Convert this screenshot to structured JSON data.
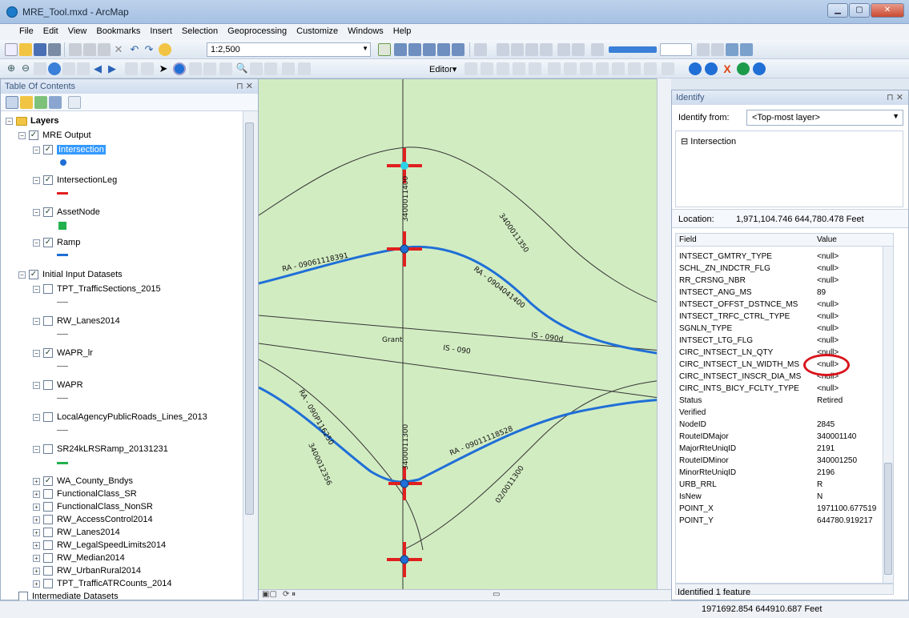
{
  "window": {
    "title": "MRE_Tool.mxd - ArcMap"
  },
  "menu": [
    "File",
    "Edit",
    "View",
    "Bookmarks",
    "Insert",
    "Selection",
    "Geoprocessing",
    "Customize",
    "Windows",
    "Help"
  ],
  "toolbar": {
    "scale": "1:2,500",
    "editor_label": "Editor▾"
  },
  "toc": {
    "title": "Table Of Contents",
    "root": "Layers",
    "groups": [
      {
        "name": "MRE Output",
        "checked": true,
        "layers": [
          {
            "name": "Intersection",
            "checked": true,
            "selected": true,
            "symbol": "blue-dot"
          },
          {
            "name": "IntersectionLeg",
            "checked": true,
            "symbol": "red-line"
          },
          {
            "name": "AssetNode",
            "checked": true,
            "symbol": "green-square"
          },
          {
            "name": "Ramp",
            "checked": true,
            "symbol": "blue-line"
          }
        ]
      },
      {
        "name": "Initial Input Datasets",
        "checked": true,
        "layers": [
          {
            "name": "TPT_TrafficSections_2015",
            "checked": false,
            "symbol": "gray-line"
          },
          {
            "name": "RW_Lanes2014",
            "checked": false,
            "symbol": "gray-line"
          },
          {
            "name": "WAPR_lr",
            "checked": true,
            "symbol": "gray-line"
          },
          {
            "name": "WAPR",
            "checked": false,
            "symbol": "gray-line"
          },
          {
            "name": "LocalAgencyPublicRoads_Lines_2013",
            "checked": false,
            "symbol": "gray-line"
          },
          {
            "name": "SR24kLRSRamp_20131231",
            "checked": false,
            "symbol": "green-line"
          },
          {
            "name": "WA_County_Bndys",
            "checked": true,
            "collapsed": true
          },
          {
            "name": "FunctionalClass_SR",
            "checked": false,
            "collapsed": true
          },
          {
            "name": "FunctionalClass_NonSR",
            "checked": false,
            "collapsed": true
          },
          {
            "name": "RW_AccessControl2014",
            "checked": false,
            "collapsed": true
          },
          {
            "name": "RW_Lanes2014",
            "checked": false,
            "collapsed": true
          },
          {
            "name": "RW_LegalSpeedLimits2014",
            "checked": false,
            "collapsed": true
          },
          {
            "name": "RW_Median2014",
            "checked": false,
            "collapsed": true
          },
          {
            "name": "RW_UrbanRural2014",
            "checked": false,
            "collapsed": true
          },
          {
            "name": "TPT_TrafficATRCounts_2014",
            "checked": false,
            "collapsed": true
          }
        ]
      },
      {
        "name": "Intermediate Datasets",
        "checked": false
      }
    ]
  },
  "map": {
    "labels": [
      "RA - 09061118391",
      "RA - 0904041400",
      "RA - 09011118528",
      "RA - 090P116250",
      "IS - 090d",
      "IS - 090",
      "Grant",
      "3400011400",
      "3400011300",
      "3400011350",
      "3400012356",
      "02/0011300"
    ]
  },
  "identify": {
    "title": "Identify",
    "from_label": "Identify from:",
    "from_value": "<Top-most layer>",
    "tree_node": "Intersection",
    "location_label": "Location:",
    "location_value": "1,971,104.746  644,780.478 Feet",
    "col_field": "Field",
    "col_value": "Value",
    "rows": [
      [
        "INTSECT_GMTRY_TYPE",
        "<null>"
      ],
      [
        "SCHL_ZN_INDCTR_FLG",
        "<null>"
      ],
      [
        "RR_CRSNG_NBR",
        "<null>"
      ],
      [
        "INTSECT_ANG_MS",
        "89"
      ],
      [
        "INTSECT_OFFST_DSTNCE_MS",
        "<null>"
      ],
      [
        "INTSECT_TRFC_CTRL_TYPE",
        "<null>"
      ],
      [
        "SGNLN_TYPE",
        "<null>"
      ],
      [
        "INTSECT_LTG_FLG",
        "<null>"
      ],
      [
        "CIRC_INTSECT_LN_QTY",
        "<null>"
      ],
      [
        "CIRC_INTSECT_LN_WIDTH_MS",
        "<null>"
      ],
      [
        "CIRC_INTSECT_INSCR_DIA_MS",
        "<null>"
      ],
      [
        "CIRC_INTS_BICY_FCLTY_TYPE",
        "<null>"
      ],
      [
        "Status",
        "Retired"
      ],
      [
        "Verified",
        ""
      ],
      [
        "NodeID",
        "2845"
      ],
      [
        "RouteIDMajor",
        "340001140"
      ],
      [
        "MajorRteUniqID",
        "2191"
      ],
      [
        "RouteIDMinor",
        "340001250"
      ],
      [
        "MinorRteUniqID",
        "2196"
      ],
      [
        "URB_RRL",
        "R"
      ],
      [
        "IsNew",
        "N"
      ],
      [
        "POINT_X",
        "1971100.677519"
      ],
      [
        "POINT_Y",
        "644780.919217"
      ]
    ],
    "footer": "Identified 1 feature"
  },
  "status": {
    "coords": "1971692.854  644910.687 Feet"
  },
  "colors": {
    "ramp": "#1f6fd6",
    "leg": "#e0201f",
    "node": "#1f6fd6",
    "intersection": "#2ad3e6",
    "assetnode": "#22b14c",
    "map_bg": "#d2ecc2"
  }
}
